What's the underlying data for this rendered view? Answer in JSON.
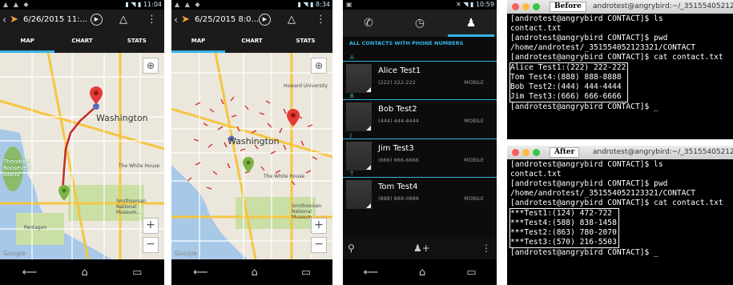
{
  "phone1": {
    "status_time": "11:04",
    "title": "6/26/2015 11:...",
    "tabs": [
      "MAP",
      "CHART",
      "STATS"
    ],
    "city_label": "Washington",
    "island_label": "Theodore Roosevelt Island",
    "places": [
      "The White House",
      "Smithsonian National Museum...",
      "Pentagon"
    ]
  },
  "phone2": {
    "status_time": "8:34",
    "title": "6/25/2015 8:0...",
    "tabs": [
      "MAP",
      "CHART",
      "STATS"
    ],
    "city_label": "Washington",
    "places": [
      "Howard University",
      "The White House",
      "Smithsonian National Museum..."
    ]
  },
  "contacts": {
    "status_time": "10:59",
    "header": "ALL CONTACTS WITH PHONE NUMBERS",
    "groups": [
      {
        "letter": "A",
        "name": "Alice Test1",
        "phone": "(222) 222-222",
        "type": "MOBILE"
      },
      {
        "letter": "B",
        "name": "Bob Test2",
        "phone": "(444) 444-4444",
        "type": "MOBILE"
      },
      {
        "letter": "J",
        "name": "Jim Test3",
        "phone": "(666) 666-6666",
        "type": "MOBILE"
      },
      {
        "letter": "T",
        "name": "Tom Test4",
        "phone": "(888) 888-0888",
        "type": "MOBILE"
      }
    ]
  },
  "terminal_before": {
    "tag": "Before",
    "window_title": "androtest@angrybird:~/_351554052123",
    "lines": [
      "[androtest@angrybird CONTACT]$ ls",
      "contact.txt",
      "[androtest@angrybird CONTACT]$ pwd",
      "/home/androtest/_351554052123321/CONTACT",
      "[androtest@angrybird CONTACT]$ cat contact.txt"
    ],
    "boxed": [
      "Alice Test1:(222) 222-222",
      "Tom Test4:(888) 888-8888",
      "Bob Test2:(444) 444-4444",
      "Jim Test3:(666) 666-6666"
    ],
    "prompt": "[androtest@angrybird CONTACT]$ _"
  },
  "terminal_after": {
    "tag": "After",
    "window_title": "androtest@angrybird:~/_351554052123",
    "lines": [
      "[androtest@angrybird CONTACT]$ ls",
      "contact.txt",
      "[androtest@angrybird CONTACT]$ pwd",
      "/home/androtest/_351554052123321/CONTACT",
      "[androtest@angrybird CONTACT]$ cat contact.txt"
    ],
    "boxed": [
      "***Test1:(124) 472-722",
      "***Test4:(588) 838-1458",
      "***Test2:(863) 780-2070",
      "***Test3:(570) 216-5503"
    ],
    "prompt": "[androtest@angrybird CONTACT]$ _"
  },
  "colors": {
    "accent": "#33b5e5",
    "route": "#d32f2f",
    "marker_red": "#e53935",
    "marker_green": "#7cb342",
    "water": "#a8c8e8",
    "park": "#c9dfa6"
  }
}
